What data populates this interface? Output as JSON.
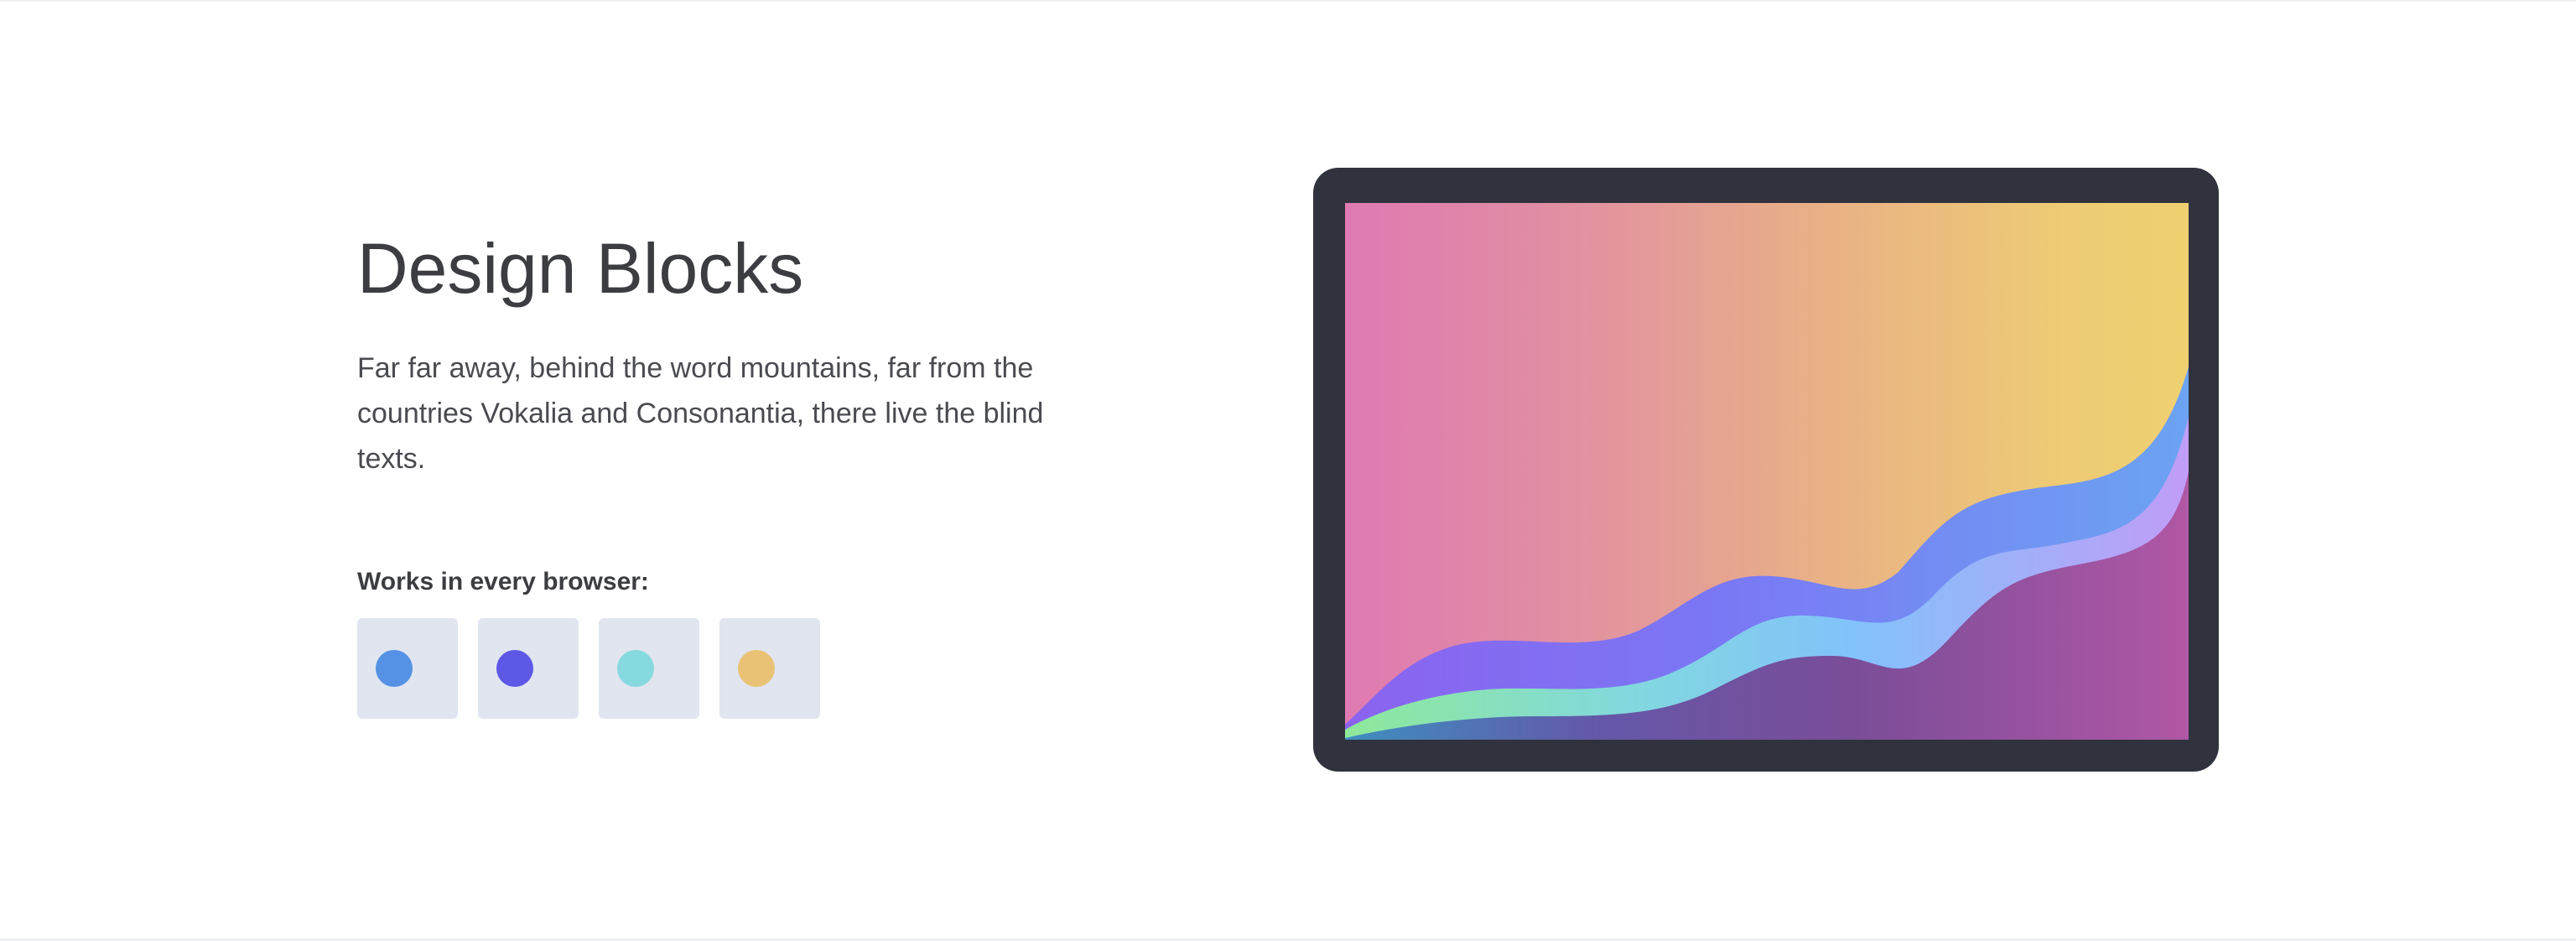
{
  "hero": {
    "title": "Design Blocks",
    "description": "Far far away, behind the word mountains, far from the countries Vokalia and Consonantia, there live the blind texts."
  },
  "browsers": {
    "label": "Works in every browser:",
    "items": [
      {
        "name": "browser-1",
        "color": "#5591e4"
      },
      {
        "name": "browser-2",
        "color": "#5d58e6"
      },
      {
        "name": "browser-3",
        "color": "#86d9de"
      },
      {
        "name": "browser-4",
        "color": "#e9c276"
      }
    ]
  },
  "colors": {
    "device_frame": "#30323d",
    "tile_bg": "#e0e5ef",
    "text": "#3c3d41"
  }
}
